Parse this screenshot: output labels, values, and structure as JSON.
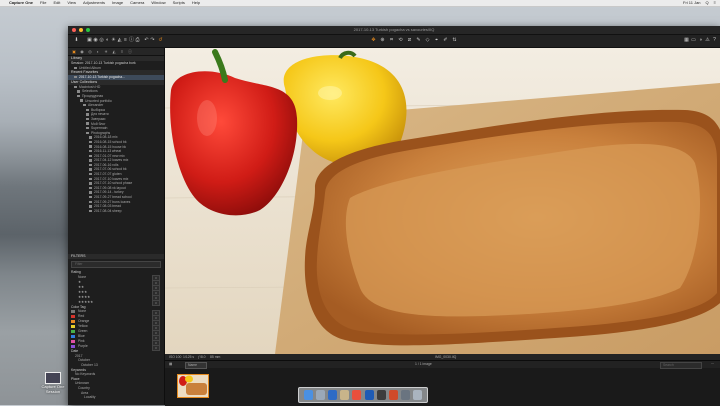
{
  "menubar": {
    "app_name": "Capture One",
    "items": [
      "File",
      "Edit",
      "View",
      "Adjustments",
      "Image",
      "Camera",
      "Window",
      "Scripts",
      "Help"
    ],
    "status": [
      "Fri 11 Jan",
      "Q",
      "≡"
    ]
  },
  "desktop": {
    "icon_label": "Capture One Session"
  },
  "window": {
    "title": "2017-10-13 Turkish pogacha vs savouries/IIQ"
  },
  "library": {
    "sections": {
      "library": "Library",
      "recent_favorites": "Recent Favorites",
      "user_collections": "User Collections",
      "filters": "FILTERS",
      "rating": "Rating",
      "color_tag": "Color Tag",
      "date": "Date",
      "keywords": "Keywords",
      "place": "Place"
    },
    "session_header": "Session: 2017-10-13 Turkish pogacha bork",
    "top_rows": [
      "Untitled Album",
      "2017-10-13 Turkish pogacha..."
    ],
    "tree": [
      "Macintosh HD",
      "Selections",
      "Процедурная",
      "Unsorted portfolio",
      "Alexander",
      "Выборка",
      "Для печати",
      "Завтраки",
      "Мой блог",
      "Supermain",
      "Photographs",
      "2016-08-18 mix",
      "2016-08-15 school bk",
      "2016-08-15 house bk",
      "2016-11-13 wheat",
      "2017-01-07 new mix",
      "2017-04-12 loaves mix",
      "2017-06-16 rolls",
      "2017-07-06 school bk",
      "2017-07-07 gluten",
      "2017-07-10 loaves mix",
      "2017-07-10 school phase",
      "2017-09-08 vk layout",
      "2017-09-14 - turkey",
      "2017-09-27 bread school",
      "2017-09-27 buns loaves",
      "2017-08-03 bread",
      "2017-08-04 sheep"
    ],
    "search_placeholder": "Filter",
    "ratings": [
      {
        "label": "None",
        "count": "0"
      },
      {
        "label": "★",
        "count": "0"
      },
      {
        "label": "★★",
        "count": "0"
      },
      {
        "label": "★★★",
        "count": "0"
      },
      {
        "label": "★★★★",
        "count": "0"
      },
      {
        "label": "★★★★★",
        "count": "0"
      }
    ],
    "color_tags": [
      {
        "label": "None",
        "color": "#777777",
        "count": "0"
      },
      {
        "label": "Red",
        "color": "#d6342c",
        "count": "0"
      },
      {
        "label": "Orange",
        "color": "#e88a23",
        "count": "0"
      },
      {
        "label": "Yellow",
        "color": "#e8cf2a",
        "count": "0"
      },
      {
        "label": "Green",
        "color": "#46b04a",
        "count": "0"
      },
      {
        "label": "Blue",
        "color": "#2f7de0",
        "count": "0"
      },
      {
        "label": "Pink",
        "color": "#e04fa0",
        "count": "0"
      },
      {
        "label": "Purple",
        "color": "#8b4fd6",
        "count": "0"
      }
    ],
    "date_rows": [
      "2017",
      "October",
      "October 13"
    ],
    "keywords_rows": [
      "No Keywords"
    ],
    "place_rows": [
      "Unknown",
      "Country",
      "Area",
      "Locality"
    ]
  },
  "viewer": {
    "bar_items": [
      "ISO 100",
      "1/125 s",
      "ƒ/8.0",
      "85 mm"
    ],
    "bar_center": "IMG_0030.IIQ",
    "accent": "#e58a1e"
  },
  "browser": {
    "sort_label": "Name",
    "count_text": "1 / 1 image",
    "search_placeholder": "Search"
  }
}
